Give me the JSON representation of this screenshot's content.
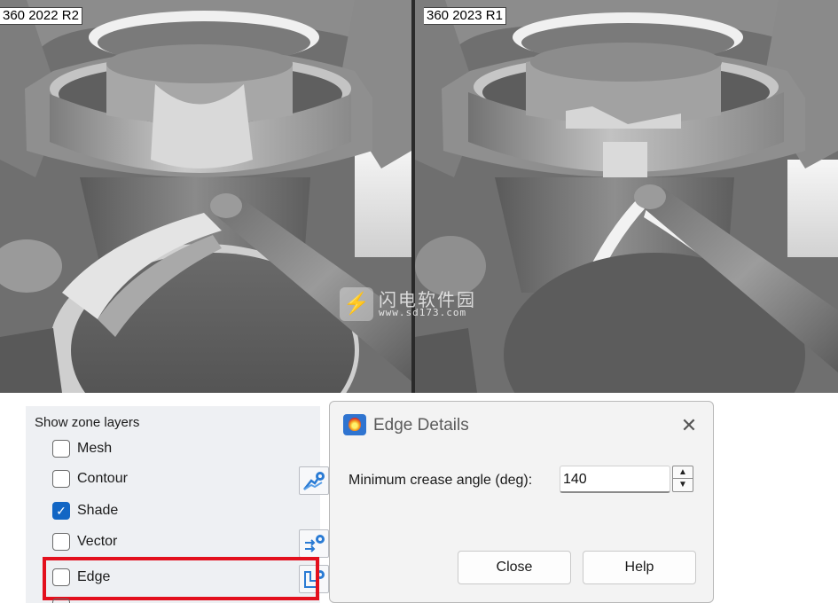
{
  "viewports": {
    "left_label": "360 2022 R2",
    "right_label": "360 2023 R1"
  },
  "watermark": {
    "title": "闪电软件园",
    "url": "www.sd173.com"
  },
  "zone_layers": {
    "title": "Show zone layers",
    "items": [
      {
        "label": "Mesh",
        "checked": false
      },
      {
        "label": "Contour",
        "checked": false
      },
      {
        "label": "Shade",
        "checked": true
      },
      {
        "label": "Vector",
        "checked": false
      },
      {
        "label": "Edge",
        "checked": false
      }
    ],
    "check_glyph": "✓"
  },
  "edge_dialog": {
    "title": "Edge Details",
    "close_glyph": "✕",
    "field_label": "Minimum crease angle (deg):",
    "field_value": "140",
    "spin_up": "▲",
    "spin_down": "▼",
    "close_button": "Close",
    "help_button": "Help"
  },
  "colors": {
    "highlight": "#e3101d",
    "checkbox_checked": "#1266c4",
    "gear_icon": "#2a7bd4"
  }
}
